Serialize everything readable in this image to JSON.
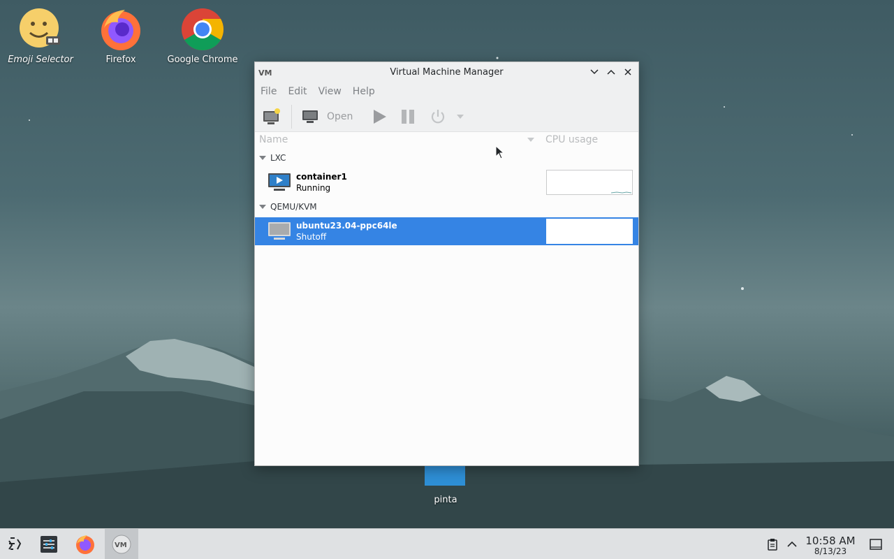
{
  "desktop": {
    "icons": [
      {
        "label": "Emoji Selector"
      },
      {
        "label": "Firefox"
      },
      {
        "label": "Google Chrome"
      },
      {
        "label": "pinta"
      }
    ]
  },
  "window": {
    "title": "Virtual Machine Manager",
    "menu": [
      "File",
      "Edit",
      "View",
      "Help"
    ],
    "toolbar": {
      "open_label": "Open"
    },
    "columns": {
      "name": "Name",
      "cpu": "CPU usage"
    },
    "groups": [
      {
        "label": "LXC",
        "vms": [
          {
            "name": "container1",
            "status": "Running"
          }
        ]
      },
      {
        "label": "QEMU/KVM",
        "vms": [
          {
            "name": "ubuntu23.04-ppc64le",
            "status": "Shutoff",
            "selected": true
          }
        ]
      }
    ],
    "selection_color": "#3584e4"
  },
  "taskbar": {
    "time": "10:58 AM",
    "date": "8/13/23"
  }
}
